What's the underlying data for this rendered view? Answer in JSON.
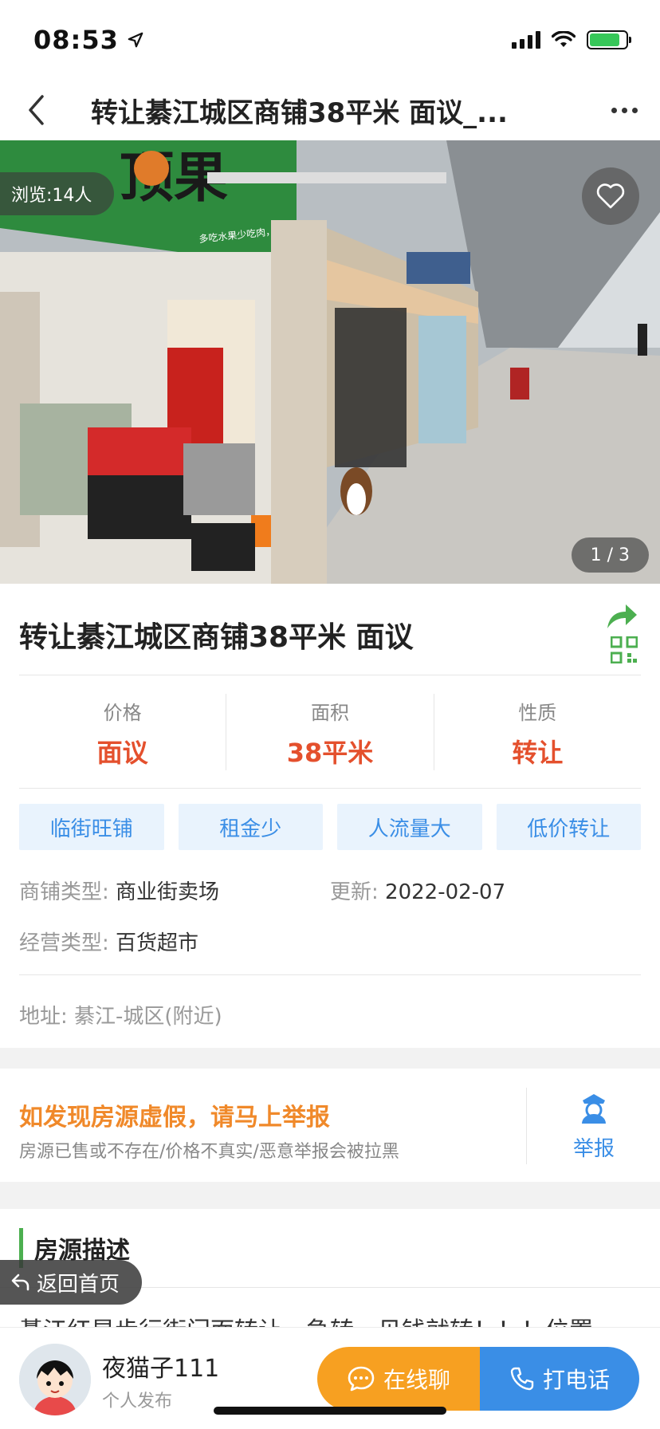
{
  "status_bar": {
    "time": "08:53",
    "battery_level": 0.85,
    "battery_color": "#37c759"
  },
  "nav": {
    "title": "转让綦江城区商铺38平米 面议_..."
  },
  "hero": {
    "views": "浏览:14人",
    "page_indicator": "1 / 3",
    "shop_sign": "顶果",
    "shop_slogan": "多吃水果少吃肉，健康又长寿"
  },
  "listing": {
    "title": "转让綦江城区商铺38平米 面议",
    "stats": [
      {
        "label": "价格",
        "value": "面议"
      },
      {
        "label": "面积",
        "value": "38平米"
      },
      {
        "label": "性质",
        "value": "转让"
      }
    ],
    "tags": [
      "临街旺铺",
      "租金少",
      "人流量大",
      "低价转让"
    ],
    "shop_type_key": "商铺类型:",
    "shop_type_val": "商业街卖场",
    "updated_key": "更新:",
    "updated_val": "2022-02-07",
    "biz_type_key": "经营类型:",
    "biz_type_val": "百货超市",
    "address_key": "地址:",
    "address_val": "綦江-城区(附近)"
  },
  "report": {
    "title": "如发现房源虚假，请马上举报",
    "subtitle": "房源已售或不存在/价格不真实/恶意举报会被拉黑",
    "button": "举报"
  },
  "description": {
    "heading": "房源描述",
    "text": "綦江红星步行街门面转让，急转，见钱就转！！！位置"
  },
  "floating": {
    "home_label": "返回首页"
  },
  "bottom_bar": {
    "poster_name": "夜猫子111",
    "poster_type": "个人发布",
    "chat_label": "在线聊",
    "call_label": "打电话"
  },
  "colors": {
    "accent_red": "#e4502d",
    "accent_blue": "#3a8ee6",
    "accent_orange": "#f7a021",
    "accent_green": "#4caf50"
  }
}
